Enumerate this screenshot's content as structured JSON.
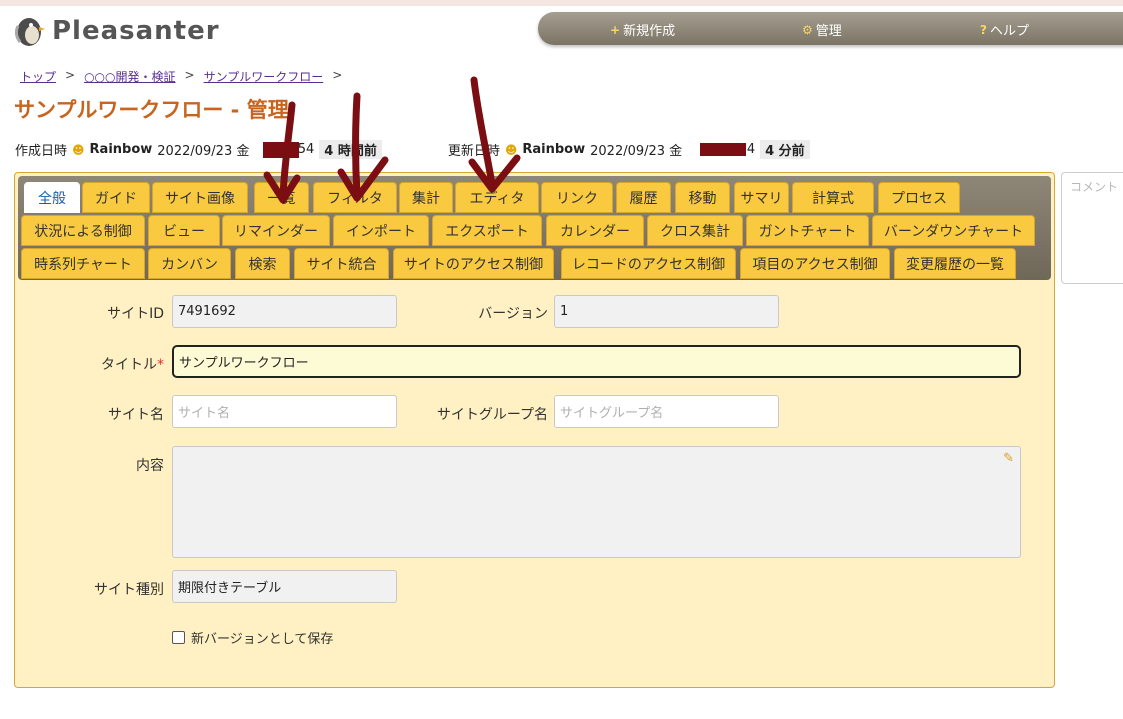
{
  "app": {
    "name": "Pleasanter"
  },
  "nav": {
    "new": "新規作成",
    "manage": "管理",
    "help": "ヘルプ",
    "new_icon": "+",
    "manage_icon": "⚙",
    "help_icon": "?"
  },
  "breadcrumb": {
    "items": [
      "トップ",
      "○○○開発・検証",
      "サンプルワークフロー"
    ],
    "sep": ">"
  },
  "page_title": "サンプルワークフロー - 管理",
  "meta": {
    "created_label": "作成日時",
    "created_user": "Rainbow",
    "created_date": "2022/09/23 金",
    "created_time_suffix": ":54",
    "created_ago": "4 時間前",
    "updated_label": "更新日時",
    "updated_user": "Rainbow",
    "updated_date": "2022/09/23 金",
    "updated_time_suffix": ":04",
    "updated_ago": "4 分前"
  },
  "tabs": {
    "row1": [
      "全般",
      "ガイド",
      "サイト画像",
      "一覧",
      "フィルタ",
      "集計",
      "エディタ",
      "リンク",
      "履歴",
      "移動",
      "サマリ",
      "計算式",
      "プロセス"
    ],
    "row2": [
      "状況による制御",
      "ビュー",
      "リマインダー",
      "インポート",
      "エクスポート",
      "カレンダー",
      "クロス集計",
      "ガントチャート",
      "バーンダウンチャート"
    ],
    "row3": [
      "時系列チャート",
      "カンバン",
      "検索",
      "サイト統合",
      "サイトのアクセス制御",
      "レコードのアクセス制御",
      "項目のアクセス制御",
      "変更履歴の一覧"
    ]
  },
  "form": {
    "site_id_label": "サイトID",
    "site_id": "7491692",
    "version_label": "バージョン",
    "version": "1",
    "title_label": "タイトル",
    "title_required": "*",
    "title": "サンプルワークフロー",
    "site_name_label": "サイト名",
    "site_name_placeholder": "サイト名",
    "site_group_label": "サイトグループ名",
    "site_group_placeholder": "サイトグループ名",
    "content_label": "内容",
    "site_type_label": "サイト種別",
    "site_type": "期限付きテーブル",
    "new_version_label": "新バージョンとして保存"
  },
  "comment": {
    "placeholder": "コメント"
  },
  "colors": {
    "accent": "#c8641e",
    "tab": "#f9c93f",
    "panel": "#fff1c4",
    "annotation": "#7a0e12"
  }
}
